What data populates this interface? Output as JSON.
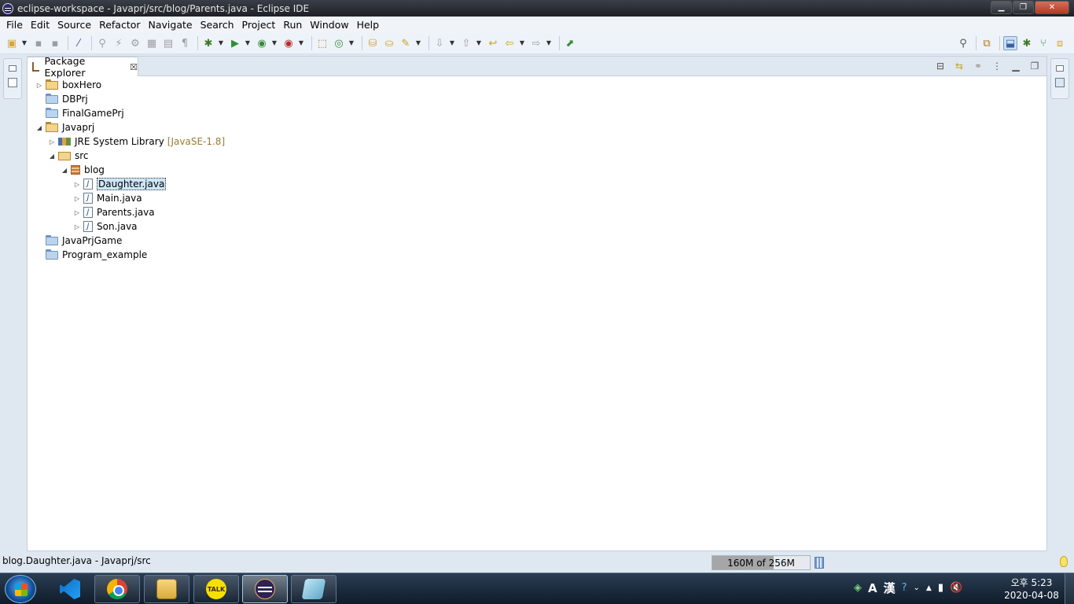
{
  "window": {
    "title": "eclipse-workspace - Javaprj/src/blog/Parents.java - Eclipse IDE",
    "minimize": "▁",
    "maximize": "❐",
    "close": "✕"
  },
  "menu": [
    "File",
    "Edit",
    "Source",
    "Refactor",
    "Navigate",
    "Search",
    "Project",
    "Run",
    "Window",
    "Help"
  ],
  "view": {
    "tab_label": "Package Explorer",
    "tab_close": "☒"
  },
  "tree": {
    "boxHero": "boxHero",
    "DBPrj": "DBPrj",
    "FinalGamePrj": "FinalGamePrj",
    "Javaprj": "Javaprj",
    "jre": "JRE System Library",
    "jre_decor": "[JavaSE-1.8]",
    "src": "src",
    "blog": "blog",
    "daughter": "Daughter.java",
    "main": "Main.java",
    "parents": "Parents.java",
    "son": "Son.java",
    "JavaPrjGame": "JavaPrjGame",
    "Program_example": "Program_example"
  },
  "status": {
    "text": "blog.Daughter.java - Javaprj/src",
    "heap": "160M of 256M",
    "heap_used_fraction": 0.625
  },
  "taskbar": {
    "talk_label": "TALK",
    "ime_a": "A",
    "ime_han": "漢",
    "clock_time": "오후 5:23",
    "clock_date": "2020-04-08"
  },
  "colors": {
    "selection": "#cde6f7",
    "decoration": "#9c7b34"
  }
}
